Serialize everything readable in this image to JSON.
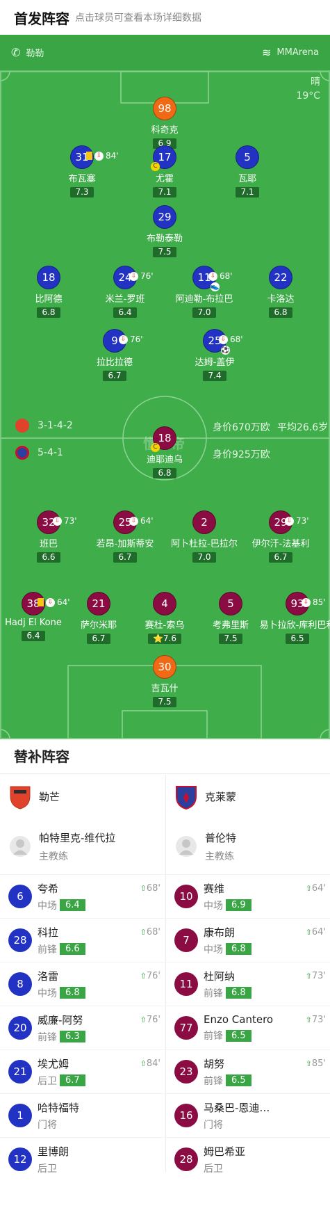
{
  "header": {
    "title": "首发阵容",
    "subtitle": "点击球员可查看本场详细数据"
  },
  "pitch": {
    "referee": "勒勒",
    "venue": "MMArena",
    "weather": "晴",
    "temperature": "19°C",
    "watermark": "懂球帝",
    "home_formation": "3-1-4-2",
    "home_value": "身价670万欧",
    "home_age": "平均26.6岁",
    "away_formation": "5-4-1",
    "away_value": "身价925万欧",
    "colors": {
      "home": "#2233c4",
      "away": "#8a0c42",
      "goalkeeper": "#f06a15",
      "pitch": "#3fae4a"
    }
  },
  "home_players": [
    {
      "num": "98",
      "name": "科奇克",
      "rating": "6.9",
      "kit": "gk"
    },
    {
      "num": "31",
      "name": "布瓦塞",
      "rating": "7.3",
      "kit": "home",
      "sub": "84'",
      "card": true
    },
    {
      "num": "17",
      "name": "尤霍",
      "rating": "7.1",
      "kit": "home",
      "captain": "C"
    },
    {
      "num": "5",
      "name": "瓦耶",
      "rating": "7.1",
      "kit": "home"
    },
    {
      "num": "29",
      "name": "布勒泰勒",
      "rating": "7.5",
      "kit": "home"
    },
    {
      "num": "18",
      "name": "比阿德",
      "rating": "6.8",
      "kit": "home"
    },
    {
      "num": "24",
      "name": "米兰-罗班",
      "rating": "6.4",
      "kit": "home",
      "sub": "76'"
    },
    {
      "num": "11",
      "name": "阿迪勒-布拉巴",
      "rating": "7.0",
      "kit": "home",
      "sub": "68'",
      "extra": true
    },
    {
      "num": "22",
      "name": "卡洛达",
      "rating": "6.8",
      "kit": "home"
    },
    {
      "num": "9",
      "name": "拉比拉德",
      "rating": "6.7",
      "kit": "home",
      "sub": "76'"
    },
    {
      "num": "25",
      "name": "达姆-盖伊",
      "rating": "7.4",
      "kit": "home",
      "sub": "68'",
      "goal": true
    }
  ],
  "away_players": [
    {
      "num": "18",
      "name": "迪耶迪乌",
      "rating": "6.8",
      "kit": "away",
      "captain": "C"
    },
    {
      "num": "32",
      "name": "班巴",
      "rating": "6.6",
      "kit": "away",
      "sub": "73'"
    },
    {
      "num": "25",
      "name": "若昂-加斯蒂安",
      "rating": "6.7",
      "kit": "away",
      "sub": "64'"
    },
    {
      "num": "2",
      "name": "阿卜杜拉-巴拉尔",
      "rating": "7.0",
      "kit": "away"
    },
    {
      "num": "29",
      "name": "伊尔汗-法基利",
      "rating": "6.7",
      "kit": "away",
      "sub": "73'"
    },
    {
      "num": "38",
      "name": "Hadj El Kone",
      "rating": "6.4",
      "kit": "away",
      "sub": "64'",
      "card": true
    },
    {
      "num": "21",
      "name": "萨尔米耶",
      "rating": "6.7",
      "kit": "away"
    },
    {
      "num": "4",
      "name": "赛杜-索乌",
      "rating": "7.6",
      "kit": "away",
      "star": "⭐"
    },
    {
      "num": "5",
      "name": "考弗里斯",
      "rating": "7.5",
      "kit": "away"
    },
    {
      "num": "93",
      "name": "易卜拉欣-库利巴利",
      "rating": "6.5",
      "kit": "away",
      "sub": "85'"
    },
    {
      "num": "30",
      "name": "吉瓦什",
      "rating": "7.5",
      "kit": "gk"
    }
  ],
  "subs": {
    "title": "替补阵容",
    "home": {
      "team": "勒芒",
      "coach": "帕特里克-维代拉",
      "coach_role": "主教练",
      "players": [
        {
          "num": "6",
          "name": "夸希",
          "pos": "中场",
          "rating": "6.4",
          "time": "68'"
        },
        {
          "num": "28",
          "name": "科拉",
          "pos": "前锋",
          "rating": "6.6",
          "time": "68'"
        },
        {
          "num": "8",
          "name": "洛雷",
          "pos": "中场",
          "rating": "6.8",
          "time": "76'"
        },
        {
          "num": "20",
          "name": "威廉-阿努",
          "pos": "前锋",
          "rating": "6.3",
          "time": "76'"
        },
        {
          "num": "21",
          "name": "埃尤姆",
          "pos": "后卫",
          "rating": "6.7",
          "time": "84'"
        },
        {
          "num": "1",
          "name": "哈特福特",
          "pos": "门将",
          "rating": "",
          "time": ""
        },
        {
          "num": "12",
          "name": "里博朗",
          "pos": "后卫",
          "rating": "",
          "time": ""
        }
      ]
    },
    "away": {
      "team": "克莱蒙",
      "coach": "普伦特",
      "coach_role": "主教练",
      "players": [
        {
          "num": "10",
          "name": "赛维",
          "pos": "中场",
          "rating": "6.9",
          "time": "64'"
        },
        {
          "num": "7",
          "name": "康布朗",
          "pos": "中场",
          "rating": "6.8",
          "time": "64'"
        },
        {
          "num": "11",
          "name": "杜阿纳",
          "pos": "前锋",
          "rating": "6.8",
          "time": "73'"
        },
        {
          "num": "77",
          "name": "Enzo Cantero",
          "pos": "前锋",
          "rating": "6.5",
          "time": "73'"
        },
        {
          "num": "23",
          "name": "胡努",
          "pos": "前锋",
          "rating": "6.5",
          "time": "85'"
        },
        {
          "num": "16",
          "name": "马桑巴-恩迪…",
          "pos": "门将",
          "rating": "",
          "time": ""
        },
        {
          "num": "28",
          "name": "姆巴希亚",
          "pos": "后卫",
          "rating": "",
          "time": ""
        }
      ]
    }
  }
}
